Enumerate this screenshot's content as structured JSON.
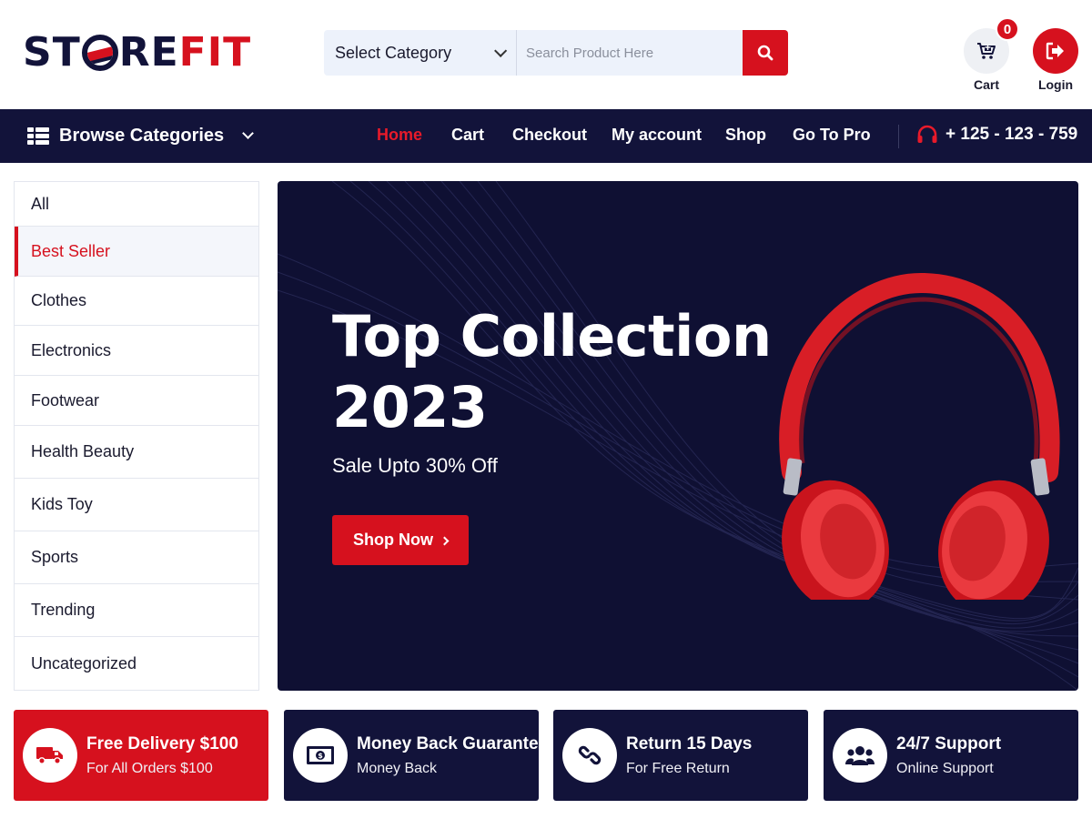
{
  "brand": {
    "logo_part1": "ST",
    "logo_part2": "RE",
    "logo_part3": "FIT",
    "primary_color": "#12133a",
    "accent_color": "#d6111e"
  },
  "search": {
    "category_label": "Select Category",
    "placeholder": "Search Product Here",
    "button_icon": "search-icon"
  },
  "header_actions": {
    "cart_label": "Cart",
    "cart_count": "0",
    "login_label": "Login"
  },
  "navbar": {
    "browse_label": "Browse Categories",
    "links": [
      "Home",
      "Cart",
      "Checkout",
      "My account",
      "Shop",
      "Go To Pro"
    ],
    "active_link": "Home",
    "phone": "+ 125 - 123 - 759"
  },
  "sidebar": {
    "items": [
      "All",
      "Best Seller",
      "Clothes",
      "Electronics",
      "Footwear",
      "Health Beauty",
      "Kids Toy",
      "Sports",
      "Trending",
      "Uncategorized"
    ],
    "active_item": "Best Seller"
  },
  "hero": {
    "title_line1": "Top Collection",
    "title_line2": "2023",
    "subtitle": "Sale Upto 30% Off",
    "button_label": "Shop Now"
  },
  "features": [
    {
      "title": "Free Delivery $100",
      "subtitle": "For All Orders $100",
      "icon": "truck-icon"
    },
    {
      "title": "Money Back Guarantee",
      "subtitle": "Money Back",
      "icon": "money-icon"
    },
    {
      "title": "Return 15 Days",
      "subtitle": "For Free Return",
      "icon": "link-icon"
    },
    {
      "title": "24/7 Support",
      "subtitle": "Online Support",
      "icon": "users-icon"
    }
  ]
}
